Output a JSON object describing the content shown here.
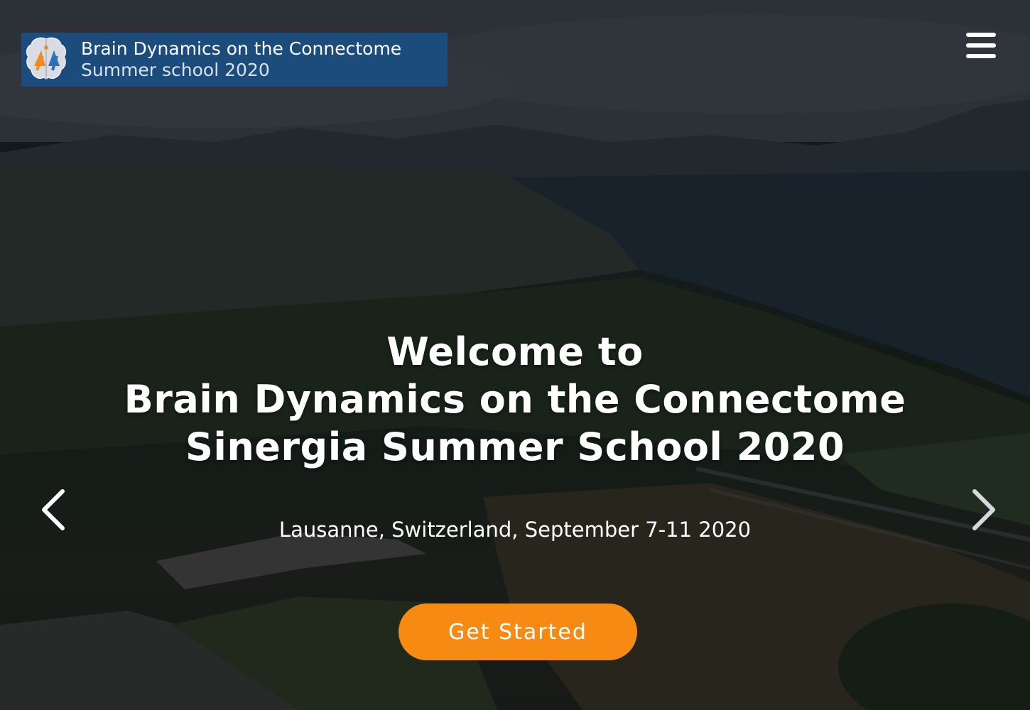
{
  "header": {
    "logo": {
      "title": "Brain Dynamics on the Connectome",
      "subtitle": "Summer school 2020",
      "icon": "brain-logo-icon",
      "background_color": "#1b4c7c"
    },
    "menu_icon": "hamburger-menu-icon"
  },
  "hero": {
    "headline": {
      "line1": "Welcome to",
      "line2": "Brain Dynamics on the Connectome",
      "line3": "Sinergia Summer School 2020"
    },
    "location": "Lausanne, Switzerland, September 7-11 2020",
    "cta_label": "Get Started",
    "cta_color": "#f68a12",
    "carousel": {
      "prev_icon": "chevron-left-icon",
      "next_icon": "chevron-right-icon"
    }
  }
}
